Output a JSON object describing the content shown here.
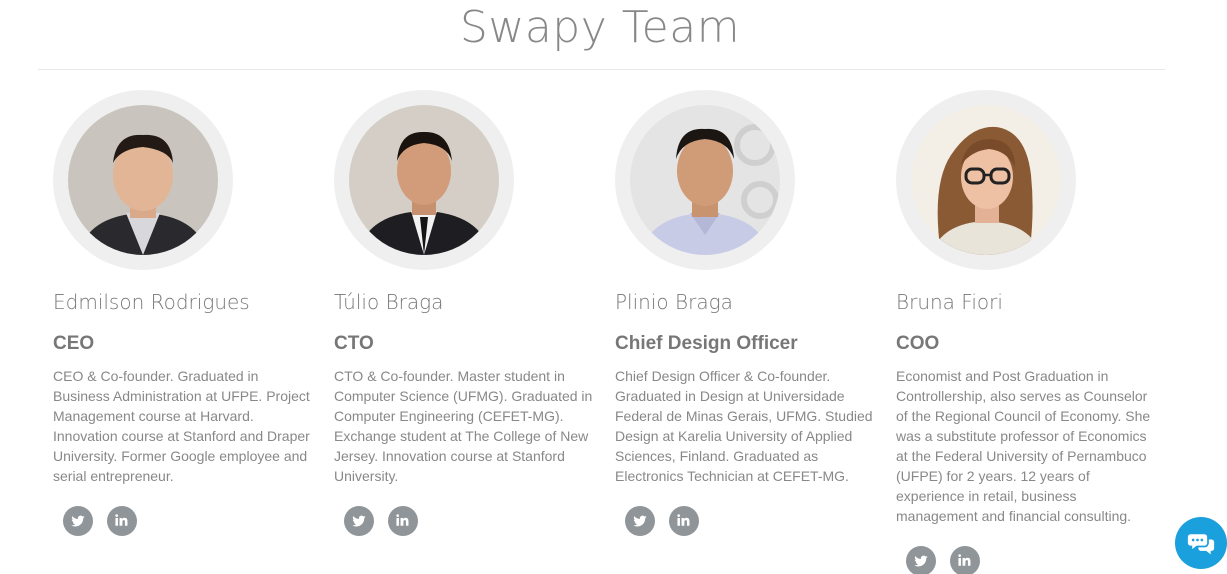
{
  "section": {
    "title": "Swapy Team"
  },
  "members": [
    {
      "name": "Edmilson Rodrigues",
      "role": "CEO",
      "bio": "CEO & Co-founder. Graduated in Business Administration at UFPE. Project Management course at Harvard. Innovation course at Stanford and Draper University. Former Google employee and serial entrepreneur.",
      "social": [
        "twitter-icon",
        "linkedin-icon"
      ]
    },
    {
      "name": "Túlio Braga",
      "role": "CTO",
      "bio": "CTO & Co-founder. Master student in Computer Science (UFMG). Graduated in Computer Engineering (CEFET-MG). Exchange student at The College of New Jersey. Innovation course at Stanford University.",
      "social": [
        "twitter-icon",
        "linkedin-icon"
      ]
    },
    {
      "name": "Plinio Braga",
      "role": "Chief Design Officer",
      "bio": "Chief Design Officer & Co-founder. Graduated in Design at Universidade Federal de Minas Gerais, UFMG. Studied Design at Karelia University of Applied Sciences, Finland. Graduated as Electronics Technician at CEFET-MG.",
      "social": [
        "twitter-icon",
        "linkedin-icon"
      ]
    },
    {
      "name": "Bruna Fiori",
      "role": "COO",
      "bio": "Economist and Post Graduation in Controllership, also serves as Counselor of the Regional Council of Economy. She was a substitute professor of Economics at the Federal University of Pernambuco (UFPE) for 2 years. 12 years of experience in retail, business management and financial consulting.",
      "social": [
        "twitter-icon",
        "linkedin-icon"
      ]
    }
  ],
  "chat": {
    "icon": "chat-icon"
  },
  "colors": {
    "social": "#8f9599",
    "chat": "#1aa0dc"
  }
}
